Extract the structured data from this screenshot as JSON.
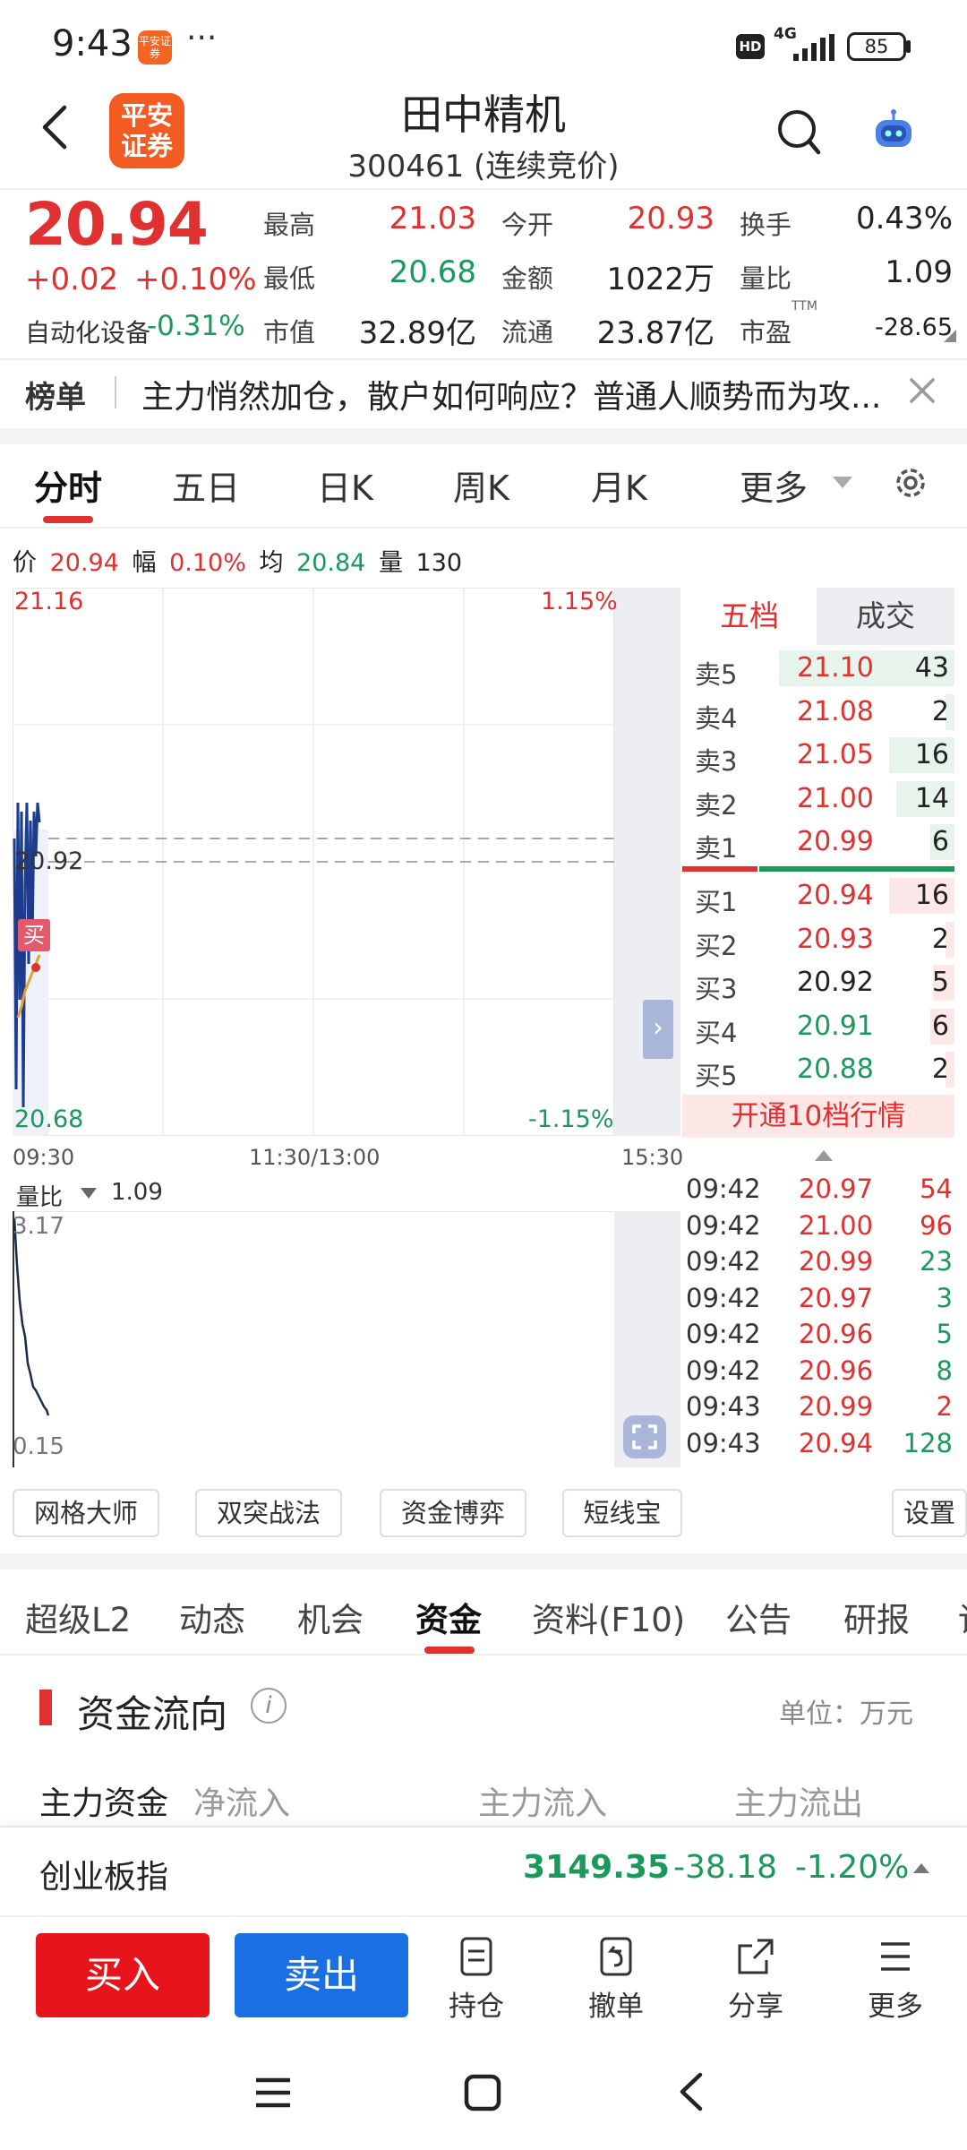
{
  "status_bar": {
    "time": "9:43",
    "dots": "···",
    "app_icon_text": "平安证券",
    "hd": "HD",
    "network": "4G",
    "battery": "85"
  },
  "header": {
    "logo_text": "平安\n证券",
    "stock_name": "田中精机",
    "stock_code_status": "300461 (连续竞价)"
  },
  "quote": {
    "last_price": "20.94",
    "change_abs": "+0.02",
    "change_pct": "+0.10%",
    "sector_label": "自动化设备",
    "sector_change": "-0.31%",
    "fields": [
      {
        "label": "最高",
        "value": "21.03",
        "color": "#e03030"
      },
      {
        "label": "今开",
        "value": "20.93",
        "color": "#e03030"
      },
      {
        "label": "换手",
        "value": "0.43%",
        "color": "#222222"
      },
      {
        "label": "最低",
        "value": "20.68",
        "color": "#1a9a5a"
      },
      {
        "label": "金额",
        "value": "1022万",
        "color": "#222222"
      },
      {
        "label": "量比",
        "value": "1.09",
        "color": "#222222"
      },
      {
        "label": "市值",
        "value": "32.89亿",
        "color": "#222222"
      },
      {
        "label": "流通",
        "value": "23.87亿",
        "color": "#222222"
      },
      {
        "label": "市盈",
        "sup": "TTM",
        "value": "-28.65",
        "color": "#222222"
      }
    ]
  },
  "rank_banner": {
    "tag": "榜单",
    "text": "主力悄然加仓，散户如何响应？普通人顺势而为攻..."
  },
  "chart_tabs": [
    "分时",
    "五日",
    "日K",
    "周K",
    "月K",
    "更多"
  ],
  "info_line": {
    "price_label": "价",
    "price": "20.94",
    "amp_label": "幅",
    "amp": "0.10%",
    "avg_label": "均",
    "avg": "20.84",
    "vol_label": "量",
    "vol": "130"
  },
  "intraday": {
    "hi_price": "21.16",
    "hi_pct": "1.15%",
    "lo_price": "20.68",
    "lo_pct": "-1.15%",
    "prev_close": "20.92",
    "buy_marker": "买",
    "expand": "›",
    "time_labels": [
      "09:30",
      "11:30/13:00",
      "15:30"
    ]
  },
  "volume_ratio": {
    "label": "量比",
    "value": "1.09",
    "max": "3.17",
    "min": "0.15"
  },
  "order_book": {
    "tab_depth": "五档",
    "tab_trades": "成交",
    "asks": [
      {
        "label": "卖5",
        "price": "21.10",
        "qty": "43",
        "color": "#e03030",
        "share": 1.0
      },
      {
        "label": "卖4",
        "price": "21.08",
        "qty": "2",
        "color": "#e03030",
        "share": 0.05
      },
      {
        "label": "卖3",
        "price": "21.05",
        "qty": "16",
        "color": "#e03030",
        "share": 0.37
      },
      {
        "label": "卖2",
        "price": "21.00",
        "qty": "14",
        "color": "#e03030",
        "share": 0.33
      },
      {
        "label": "卖1",
        "price": "20.99",
        "qty": "6",
        "color": "#e03030",
        "share": 0.14
      }
    ],
    "bids": [
      {
        "label": "买1",
        "price": "20.94",
        "qty": "16",
        "color": "#e03030",
        "share": 0.37
      },
      {
        "label": "买2",
        "price": "20.93",
        "qty": "2",
        "color": "#e03030",
        "share": 0.05
      },
      {
        "label": "买3",
        "price": "20.92",
        "qty": "5",
        "color": "#222222",
        "share": 0.12
      },
      {
        "label": "买4",
        "price": "20.91",
        "qty": "6",
        "color": "#1a9a5a",
        "share": 0.14
      },
      {
        "label": "买5",
        "price": "20.88",
        "qty": "2",
        "color": "#1a9a5a",
        "share": 0.05
      }
    ],
    "upgrade": "开通10档行情"
  },
  "ticks": [
    {
      "time": "09:42",
      "price": "20.97",
      "vol": "54",
      "pcolor": "#e03030",
      "vcolor": "#e03030"
    },
    {
      "time": "09:42",
      "price": "21.00",
      "vol": "96",
      "pcolor": "#e03030",
      "vcolor": "#e03030"
    },
    {
      "time": "09:42",
      "price": "20.99",
      "vol": "23",
      "pcolor": "#e03030",
      "vcolor": "#1a9a5a"
    },
    {
      "time": "09:42",
      "price": "20.97",
      "vol": "3",
      "pcolor": "#e03030",
      "vcolor": "#1a9a5a"
    },
    {
      "time": "09:42",
      "price": "20.96",
      "vol": "5",
      "pcolor": "#e03030",
      "vcolor": "#1a9a5a"
    },
    {
      "time": "09:42",
      "price": "20.96",
      "vol": "8",
      "pcolor": "#e03030",
      "vcolor": "#1a9a5a"
    },
    {
      "time": "09:43",
      "price": "20.99",
      "vol": "2",
      "pcolor": "#e03030",
      "vcolor": "#e03030"
    },
    {
      "time": "09:43",
      "price": "20.94",
      "vol": "128",
      "pcolor": "#e03030",
      "vcolor": "#1a9a5a"
    }
  ],
  "chips": [
    "网格大师",
    "双突战法",
    "资金博弈",
    "短线宝",
    "设置"
  ],
  "detail_tabs": [
    "超级L2",
    "动态",
    "机会",
    "资金",
    "资料(F10)",
    "公告",
    "研报",
    "讨"
  ],
  "fund_flow": {
    "title": "资金流向",
    "info": "i",
    "unit": "单位：万元",
    "main_label": "主力资金",
    "net_in": "净流入",
    "in_label": "主力流入",
    "out_label": "主力流出"
  },
  "index_ticker": {
    "name": "创业板指",
    "value": "3149.35",
    "change": "-38.18",
    "pct": "-1.20%"
  },
  "actions": {
    "buy": "买入",
    "sell": "卖出",
    "items": [
      "持仓",
      "撤单",
      "分享",
      "更多"
    ]
  },
  "colors": {
    "up": "#e03030",
    "down": "#1a9a5a",
    "accent": "#f25c22",
    "sell_blue": "#1a6fe3"
  }
}
